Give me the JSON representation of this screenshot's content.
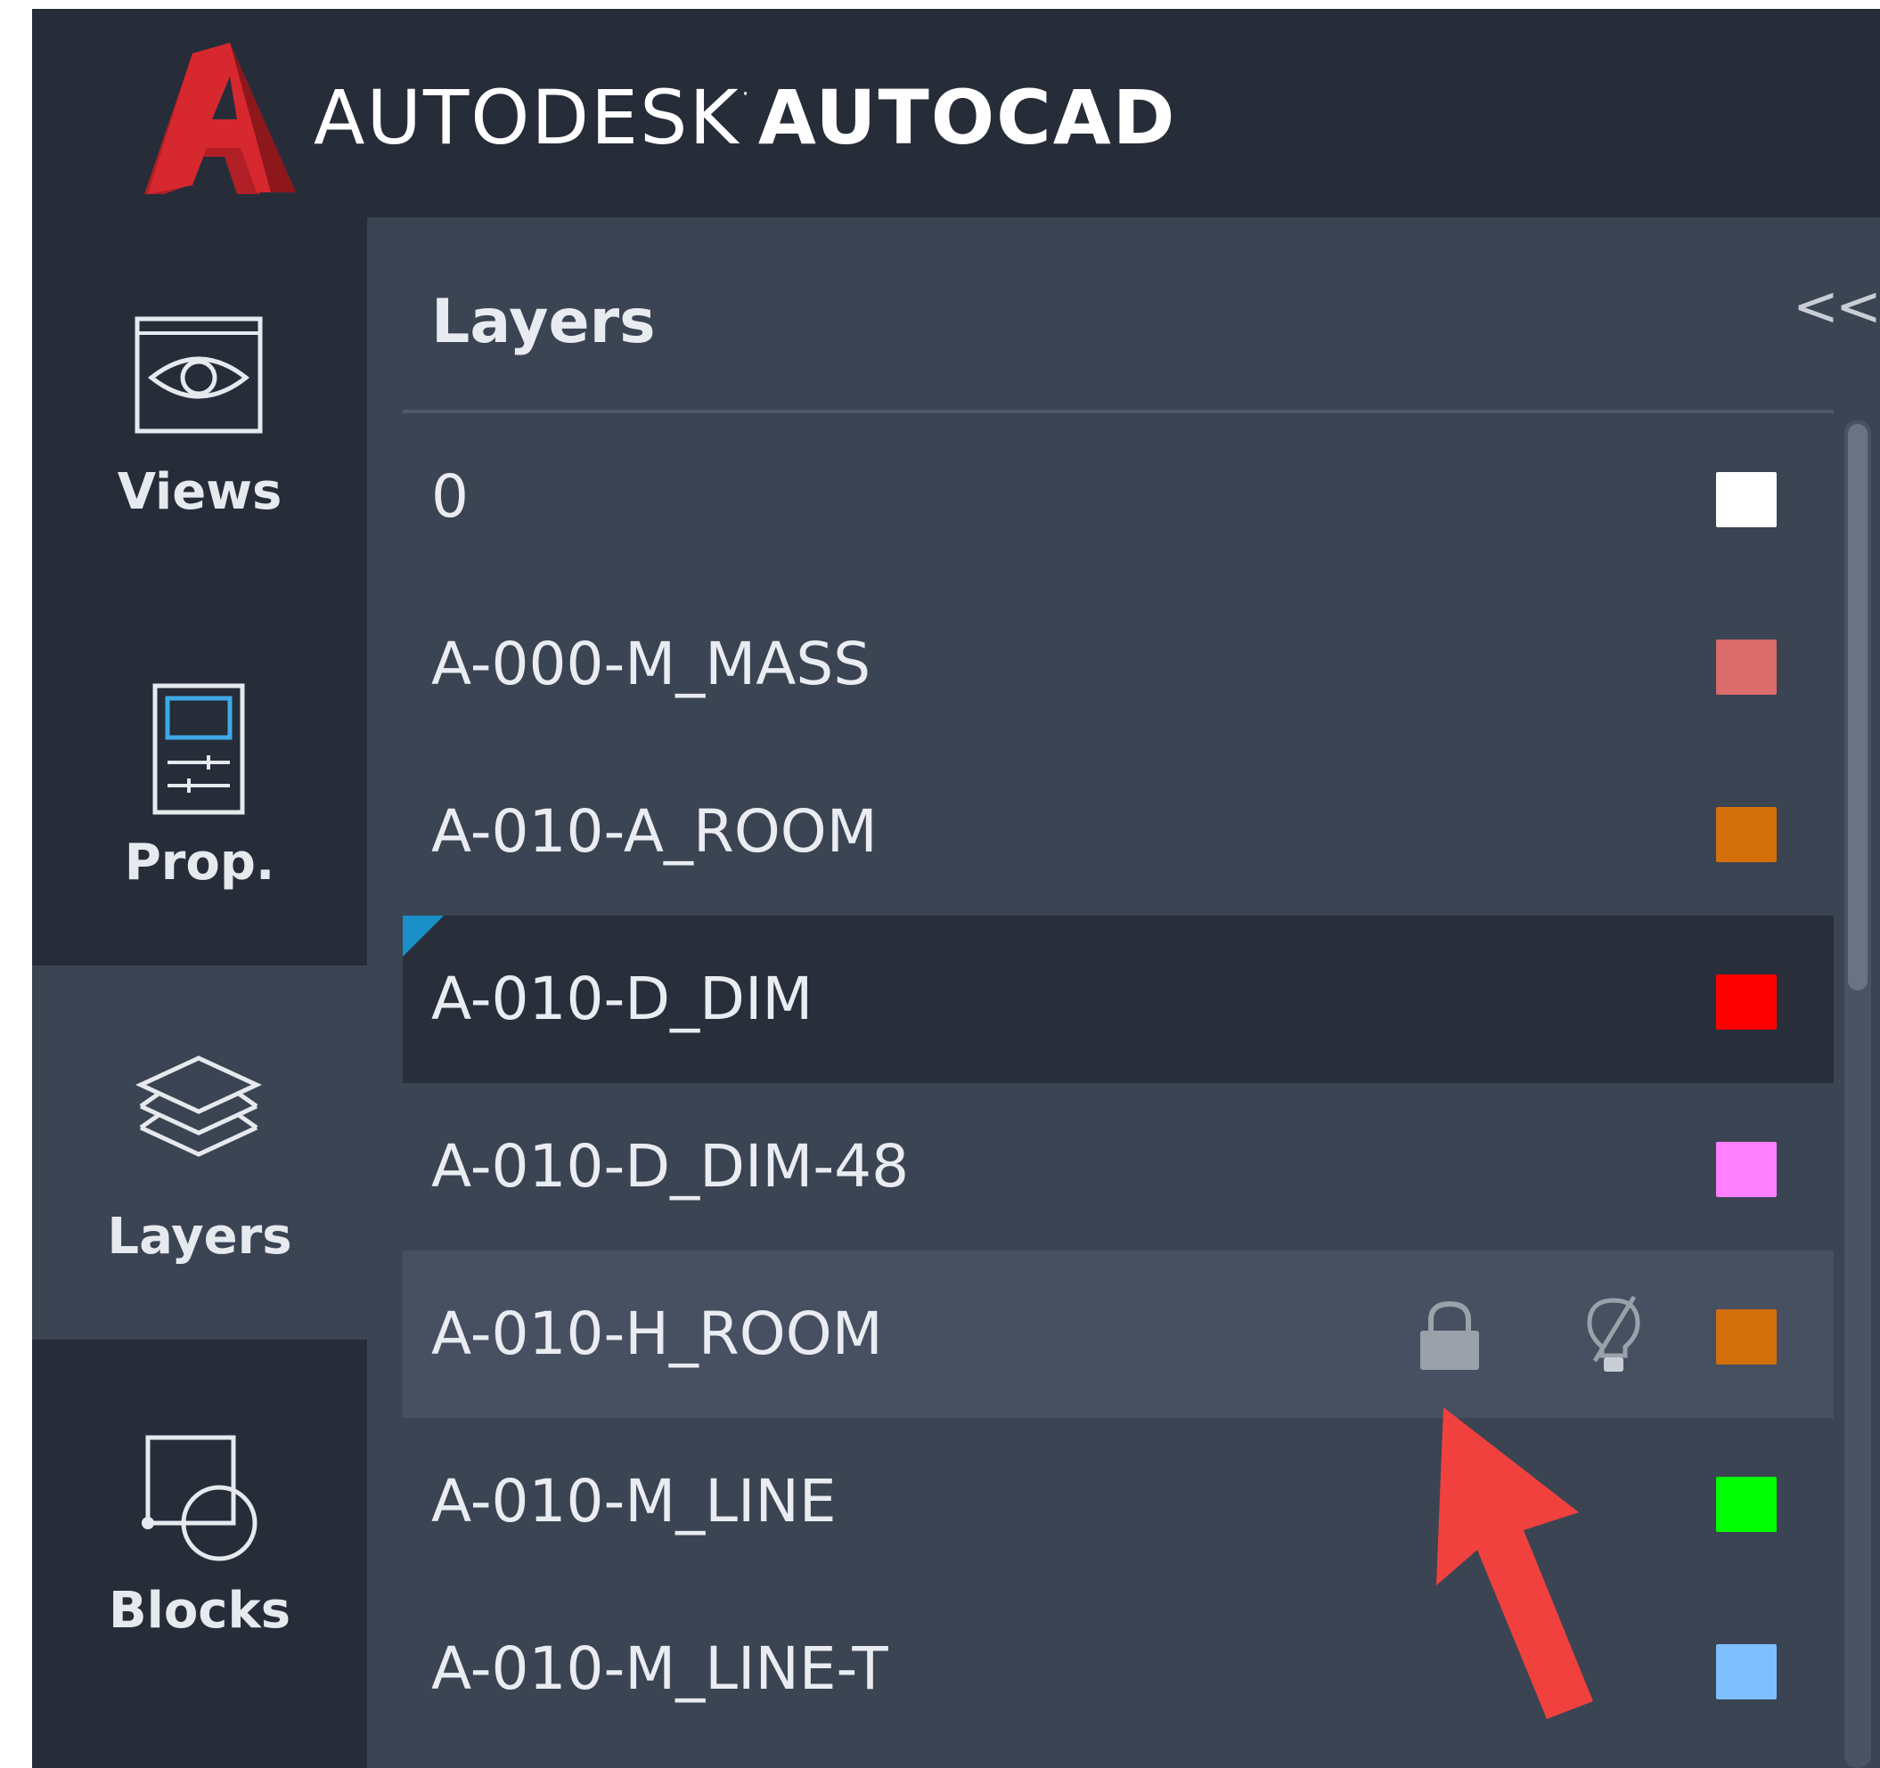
{
  "header": {
    "brand_light": "AUTODESK",
    "brand_bold": "AUTOCAD",
    "logo_color": "#d7282f"
  },
  "sidebar": {
    "items": [
      {
        "label": "Views",
        "icon": "eye-icon",
        "active": false
      },
      {
        "label": "Prop.",
        "icon": "properties-icon",
        "active": false
      },
      {
        "label": "Layers",
        "icon": "layers-icon",
        "active": true
      },
      {
        "label": "Blocks",
        "icon": "blocks-icon",
        "active": false
      }
    ]
  },
  "panel": {
    "title": "Layers",
    "collapse_label": "<<",
    "layers": [
      {
        "name": "0",
        "color": "#ffffff"
      },
      {
        "name": "A-000-M_MASS",
        "color": "#dc6b6b"
      },
      {
        "name": "A-010-A_ROOM",
        "color": "#d4700a"
      },
      {
        "name": "A-010-D_DIM",
        "color": "#ff0000",
        "selected": true,
        "current": true
      },
      {
        "name": "A-010-D_DIM-48",
        "color": "#ff80ff"
      },
      {
        "name": "A-010-H_ROOM",
        "color": "#d4700a",
        "hover": true,
        "icons": [
          "lock-icon",
          "lightbulb-off-icon"
        ]
      },
      {
        "name": "A-010-M_LINE",
        "color": "#00ff00"
      },
      {
        "name": "A-010-M_LINE-T",
        "color": "#7fbfff"
      }
    ]
  },
  "annotation": {
    "arrow_color": "#f0413f",
    "icon_color": "#9aa1ab"
  }
}
